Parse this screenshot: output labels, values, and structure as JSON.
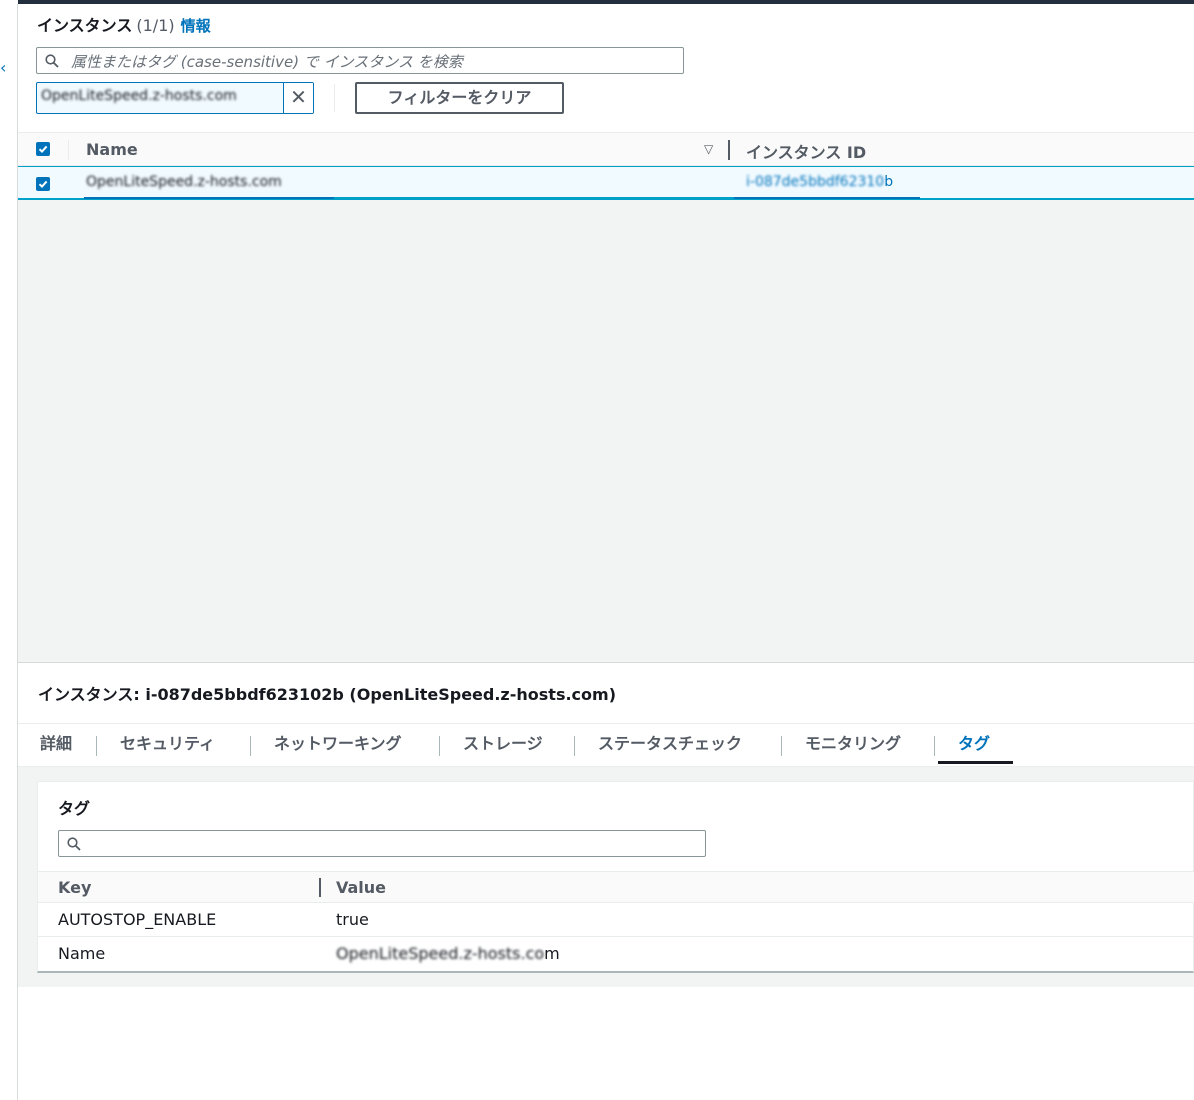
{
  "colors": {
    "accent": "#0073bb",
    "selected_row_bg": "#f1faff",
    "top_bar": "#232f3e"
  },
  "instances_header": {
    "title": "インスタンス",
    "count": "(1/1)",
    "info_link": "情報"
  },
  "search": {
    "placeholder": "属性またはタグ (case-sensitive) で インスタンス を検索",
    "icon": "search-icon"
  },
  "filter_token": {
    "value": "OpenLiteSpeed.z-hosts.com",
    "close_icon": "close-icon"
  },
  "clear_filters_label": "フィルターをクリア",
  "table": {
    "columns": [
      "Name",
      "インスタンス ID"
    ],
    "rows": [
      {
        "name": "OpenLiteSpeed.z-hosts.com",
        "instance_id_prefix": "i-087de5bbdf62310",
        "instance_id_suffix": "b"
      }
    ]
  },
  "detail": {
    "title": "インスタンス: i-087de5bbdf623102b (OpenLiteSpeed.z-hosts.com)",
    "tabs": [
      "詳細",
      "セキュリティ",
      "ネットワーキング",
      "ストレージ",
      "ステータスチェック",
      "モニタリング",
      "タグ"
    ],
    "active_tab": "タグ"
  },
  "tags": {
    "title": "タグ",
    "columns": [
      "Key",
      "Value"
    ],
    "rows": [
      {
        "key": "AUTOSTOP_ENABLE",
        "value": "true"
      },
      {
        "key": "Name",
        "value_prefix": "OpenLiteSpeed.z-hosts.co",
        "value_suffix": "m"
      }
    ]
  }
}
